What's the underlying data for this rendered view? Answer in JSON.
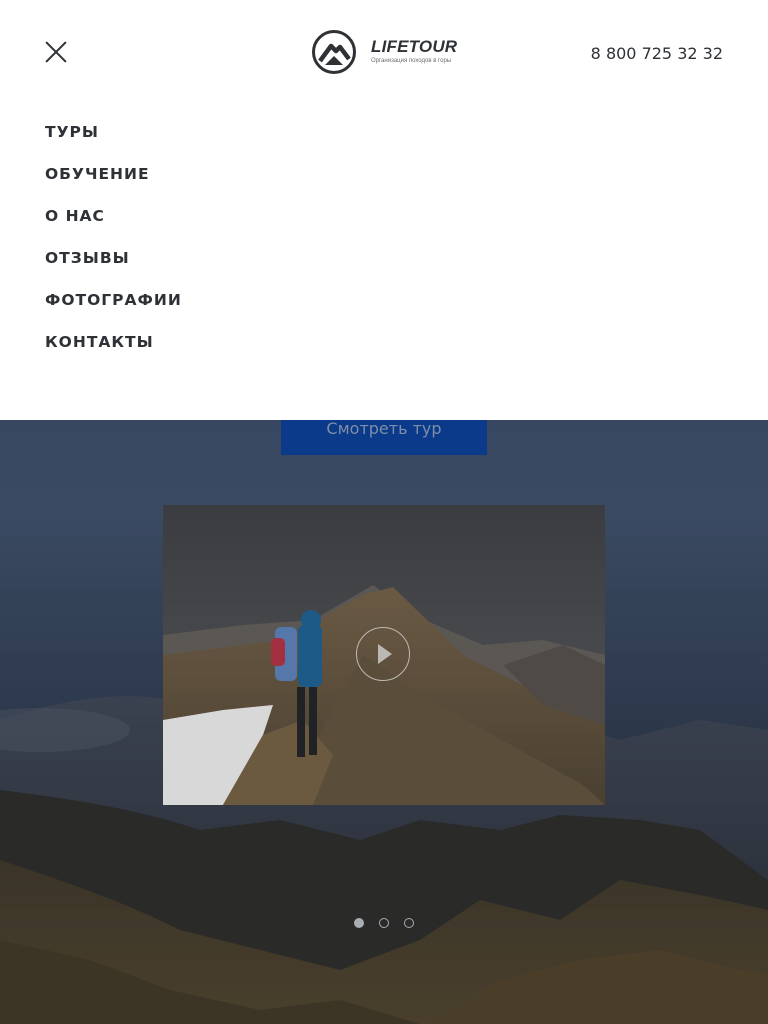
{
  "header": {
    "logo": {
      "name": "LIFETOUR",
      "tagline": "Организация походов в горы"
    },
    "phone": "8 800 725 32 32"
  },
  "menu": {
    "items": [
      {
        "label": "ТУРЫ"
      },
      {
        "label": "ОБУЧЕНИЕ"
      },
      {
        "label": "О НАС"
      },
      {
        "label": "ОТЗЫВЫ"
      },
      {
        "label": "ФОТОГРАФИИ"
      },
      {
        "label": "КОНТАКТЫ"
      }
    ]
  },
  "hero": {
    "button_label": "Смотреть тур"
  },
  "slider": {
    "slide_count": 3,
    "active_index": 0
  },
  "colors": {
    "accent": "#0b3a8a",
    "text": "#2e3236",
    "menu_bg": "#ffffff"
  },
  "icons": [
    "close-icon",
    "logo-mountain-icon",
    "play-icon"
  ]
}
